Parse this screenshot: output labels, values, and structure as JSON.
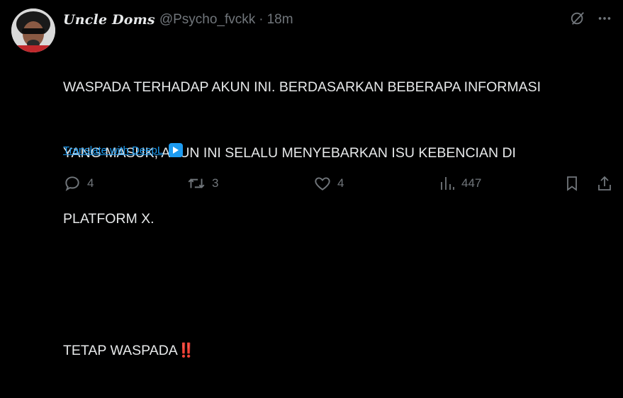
{
  "tweet": {
    "display_name": "Uncle Doms",
    "handle": "@Psycho_fvckk",
    "separator": "·",
    "time": "18m",
    "lines": [
      "WASPADA TERHADAP AKUN INI. BERDASARKAN BEBERAPA INFORMASI",
      "YANG MASUK, AKUN INI SELALU MENYEBARKAN ISU KEBENCIAN DI",
      "PLATFORM X.",
      "",
      "TETAP WASPADA"
    ],
    "emoji": "‼️"
  },
  "translate": {
    "label": "Translate with DeepL"
  },
  "metrics": {
    "replies": "4",
    "reposts": "3",
    "likes": "4",
    "views": "447"
  },
  "icons": {
    "grok": "grok-icon",
    "more": "more-icon",
    "reply": "reply-icon",
    "repost": "repost-icon",
    "like": "heart-icon",
    "views": "views-icon",
    "bookmark": "bookmark-icon",
    "share": "share-icon",
    "deepl": "deepl-icon"
  },
  "colors": {
    "background": "#000000",
    "text": "#e7e9ea",
    "muted": "#71767b",
    "link": "#1d9bf0",
    "emoji_red": "#e0245e"
  }
}
